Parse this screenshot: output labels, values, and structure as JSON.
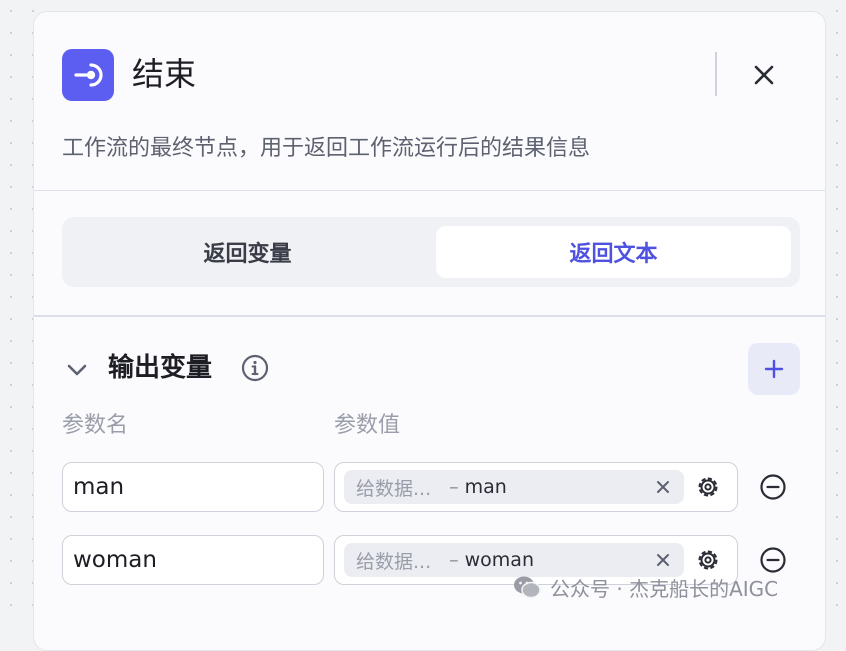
{
  "node": {
    "title": "结束",
    "icon": "end-node-icon",
    "description": "工作流的最终节点，用于返回工作流运行后的结果信息",
    "accent_color": "#5b5ef0"
  },
  "mode_tabs": [
    {
      "label": "返回变量",
      "active": false
    },
    {
      "label": "返回文本",
      "active": true
    }
  ],
  "output_section": {
    "title": "输出变量",
    "columns": {
      "name": "参数名",
      "value": "参数值"
    },
    "rows": [
      {
        "name": "man",
        "value_source": "给数据...",
        "value_sep": "–",
        "value_var": "man"
      },
      {
        "name": "woman",
        "value_source": "给数据...",
        "value_sep": "–",
        "value_var": "woman"
      }
    ]
  },
  "watermark": {
    "text": "公众号 · 杰克船长的AIGC",
    "icon": "wechat-icon"
  }
}
